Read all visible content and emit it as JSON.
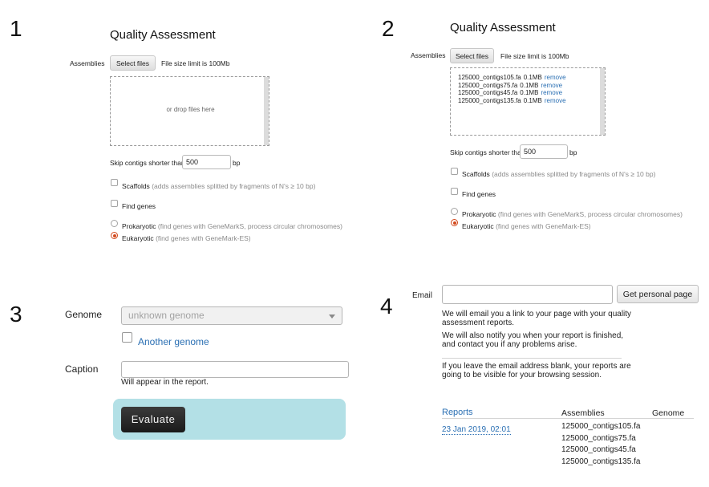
{
  "panel_numbers": [
    "1",
    "2",
    "3",
    "4"
  ],
  "panel1": {
    "title": "Quality Assessment",
    "assemblies_label": "Assemblies",
    "select_files_label": "Select files",
    "file_size_limit": "File size limit is 100Mb",
    "drop_text": "or drop files here",
    "skip_label": "Skip contigs shorter than",
    "skip_value": "500",
    "skip_unit": "bp",
    "scaffolds_label": "Scaffolds",
    "scaffolds_hint": "(adds assemblies splitted by fragments of N's ≥ 10 bp)",
    "find_genes_label": "Find genes",
    "prokaryotic_label": "Prokaryotic",
    "prokaryotic_hint": "(find genes with GeneMarkS, process circular chromosomes)",
    "eukaryotic_label": "Eukaryotic",
    "eukaryotic_hint": "(find genes with GeneMark-ES)"
  },
  "panel2": {
    "title": "Quality Assessment",
    "assemblies_label": "Assemblies",
    "select_files_label": "Select files",
    "file_size_limit": "File size limit is 100Mb",
    "files": [
      {
        "name": "125000_contigs105.fa",
        "size": "0.1MB",
        "action": "remove"
      },
      {
        "name": "125000_contigs75.fa",
        "size": "0.1MB",
        "action": "remove"
      },
      {
        "name": "125000_contigs45.fa",
        "size": "0.1MB",
        "action": "remove"
      },
      {
        "name": "125000_contigs135.fa",
        "size": "0.1MB",
        "action": "remove"
      }
    ],
    "skip_label": "Skip contigs shorter than",
    "skip_value": "500",
    "skip_unit": "bp",
    "scaffolds_label": "Scaffolds",
    "scaffolds_hint": "(adds assemblies splitted by fragments of N's ≥ 10 bp)",
    "find_genes_label": "Find genes",
    "prokaryotic_label": "Prokaryotic",
    "prokaryotic_hint": "(find genes with GeneMarkS, process circular chromosomes)",
    "eukaryotic_label": "Eukaryotic",
    "eukaryotic_hint": "(find genes with GeneMark-ES)"
  },
  "panel3": {
    "genome_label": "Genome",
    "genome_value": "unknown genome",
    "another_genome_label": "Another genome",
    "caption_label": "Caption",
    "caption_hint": "Will appear in the report.",
    "evaluate_label": "Evaluate"
  },
  "panel4": {
    "email_label": "Email",
    "email_value": "",
    "get_page_label": "Get personal page",
    "para1_line1": "We will email you a link to your page with your quality",
    "para1_line2": "assessment reports.",
    "para2_line1": "We will also notify you when your report is finished,",
    "para2_line2": "and contact you if any problems arise.",
    "para3_line1": "If you leave the email address blank, your reports are",
    "para3_line2": "going to be visible for your browsing session.",
    "table": {
      "headers": [
        "Reports",
        "Assemblies",
        "Genome"
      ],
      "date": "23 Jan 2019, 02:01",
      "assemblies": [
        "125000_contigs105.fa",
        "125000_contigs75.fa",
        "125000_contigs45.fa",
        "125000_contigs135.fa"
      ]
    }
  },
  "colors": {
    "link": "#2a6fb3",
    "radio_selected": "#d24a1e",
    "evaluate_panel": "#b3e0e6",
    "evaluate_button": "#222222"
  }
}
